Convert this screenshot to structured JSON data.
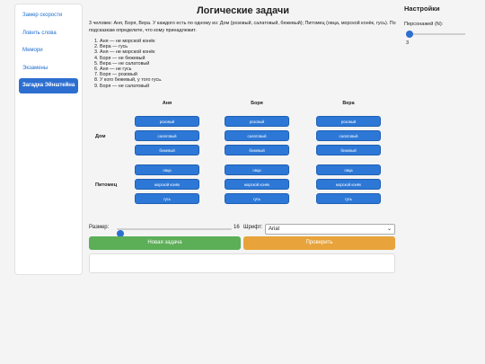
{
  "sidebar": {
    "items": [
      {
        "label": "Замер скорости"
      },
      {
        "label": "Ловить слова"
      },
      {
        "label": "Мемори"
      },
      {
        "label": "Экзамены"
      },
      {
        "label": "Загадка Эйнштейна",
        "active": true
      }
    ]
  },
  "main": {
    "title": "Логические задачи",
    "intro": "3 человек: Аня, Боря, Вера. У каждого есть по одному из: Дом (розовый, салатовый, бежевый); Питомец (овца, морской конёк, гусь). По подсказкам определите, что кому принадлежит.",
    "clues": [
      "Аня — не морской конёк",
      "Вера — гусь",
      "Аня — не морской конёк",
      "Боря — не бежевый",
      "Вера — не салатовый",
      "Аня — не гусь",
      "Боря — розовый",
      "У кого бежевый, у того гусь.",
      "Боря — не салатовый"
    ],
    "people": [
      "Аня",
      "Боря",
      "Вера"
    ],
    "attributes": [
      {
        "label": "Дом",
        "options": [
          "розовый",
          "салатовый",
          "бежевый"
        ]
      },
      {
        "label": "Питомец",
        "options": [
          "овца",
          "морской конёк",
          "гусь"
        ]
      }
    ],
    "controls": {
      "size_label": "Размер:",
      "size_value": "16",
      "size_min": 12,
      "font_label": "Шрифт:",
      "font_value": "Arial"
    },
    "buttons": {
      "new_task": "Новая задача",
      "check": "Проверить"
    }
  },
  "settings": {
    "title": "Настройки",
    "persons_label": "Персонажей (N):",
    "persons_value": "3"
  },
  "colors": {
    "accent": "#2d6fd1",
    "option_blue": "#2d78d6",
    "new_green": "#5cae57",
    "check_orange": "#e8a33a"
  }
}
